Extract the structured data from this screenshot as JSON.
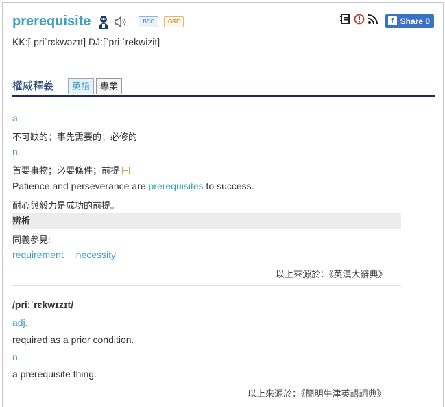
{
  "header": {
    "word": "prerequisite",
    "tags": [
      "BEC",
      "GRE"
    ],
    "pronunciation": "KK:[ˌpriˈrɛkwəzɪt] DJ:[ˈpriːˈrekwizit]",
    "share_label": "Share 0",
    "icons": [
      "user-learner-icon",
      "speaker-icon",
      "notebook-icon",
      "report-icon",
      "rss-icon",
      "facebook-icon"
    ]
  },
  "tabs": {
    "section_title": "權威釋義",
    "items": [
      "英語",
      "專業"
    ],
    "active": "英語"
  },
  "entry1": {
    "pos_a": "a.",
    "def_a": "不可缺的；事先需要的；必修的",
    "pos_n": "n.",
    "def_n": "首要事物；必要條件；前提",
    "example_before": "Patience and perseverance are ",
    "example_link": "prerequisites",
    "example_after": " to success.",
    "example_zh": "耐心與毅力是成功的前提。",
    "analysis_label": "辨析",
    "synonyms_label": "同義參見:",
    "synonyms": [
      "requirement",
      "necessity"
    ],
    "source": "以上來源於：《英漢大辭典》"
  },
  "entry2": {
    "pron": "/priːˈrɛkwɪzɪt/",
    "pos_adj": "adj.",
    "def_adj": "required as a prior condition.",
    "pos_n": "n.",
    "def_n": "a prerequisite thing.",
    "source": "以上來源於：《簡明牛津英語詞典》"
  },
  "colors": {
    "accent": "#3e9fbf",
    "share": "#3b73c4",
    "tab_line": "#1a2a6c"
  }
}
